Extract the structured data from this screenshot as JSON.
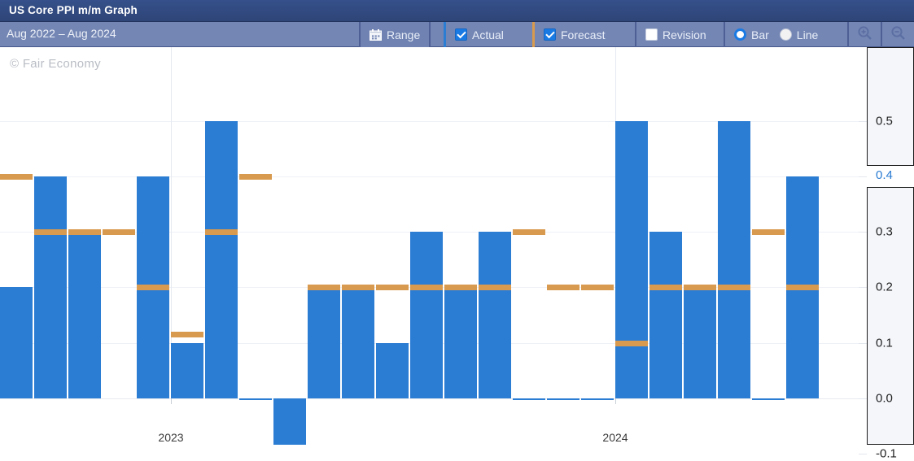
{
  "window": {
    "title": "US Core PPI m/m Graph"
  },
  "toolbar": {
    "date_range": "Aug 2022 – Aug 2024",
    "range_label": "Range",
    "range_icon": "calendar-icon",
    "actual_label": "Actual",
    "actual_checked": true,
    "forecast_label": "Forecast",
    "forecast_checked": true,
    "revision_label": "Revision",
    "revision_checked": false,
    "bar_label": "Bar",
    "bar_selected": true,
    "line_label": "Line",
    "line_selected": false,
    "zoom_in_icon": "zoom-in-icon",
    "zoom_out_icon": "zoom-out-icon"
  },
  "watermark": "© Fair Economy",
  "colors": {
    "actual": "#2b7cd3",
    "forecast": "#d89a4e",
    "titlebar": "#2e4577",
    "toolbar": "#7486b4",
    "highlight_value": "#2b7cd3"
  },
  "axis": {
    "y_ticks": [
      "0.5",
      "0.4",
      "0.3",
      "0.2",
      "0.1",
      "0.0",
      "-0.1"
    ],
    "y_highlight": "0.4",
    "x_ticks": [
      "2023",
      "2024"
    ]
  },
  "chart_data": {
    "type": "bar",
    "title": "US Core PPI m/m Graph",
    "subtitle": "Aug 2022 – Aug 2024",
    "xlabel": "",
    "ylabel": "",
    "ylim": [
      -0.12,
      0.56
    ],
    "grid": true,
    "legend": [
      "Actual",
      "Forecast"
    ],
    "legend_position": "toolbar",
    "x_tick_labels": [
      "2023",
      "2024"
    ],
    "x_tick_indices": [
      5,
      18
    ],
    "series": [
      {
        "name": "Actual",
        "color": "#2b7cd3",
        "values": [
          0.2,
          0.4,
          0.3,
          null,
          0.4,
          0.1,
          0.5,
          0.0,
          -0.1,
          0.2,
          0.2,
          0.1,
          0.3,
          0.2,
          0.3,
          0.0,
          0.0,
          0.0,
          0.5,
          0.3,
          0.2,
          0.5,
          0.0,
          0.4
        ]
      },
      {
        "name": "Forecast",
        "color": "#d89a4e",
        "values": [
          0.4,
          0.3,
          0.3,
          0.3,
          0.2,
          0.115,
          0.3,
          0.4,
          null,
          0.2,
          0.2,
          0.2,
          0.2,
          0.2,
          0.2,
          0.3,
          0.2,
          0.2,
          0.1,
          0.2,
          0.2,
          0.2,
          0.3,
          0.2
        ]
      }
    ]
  }
}
